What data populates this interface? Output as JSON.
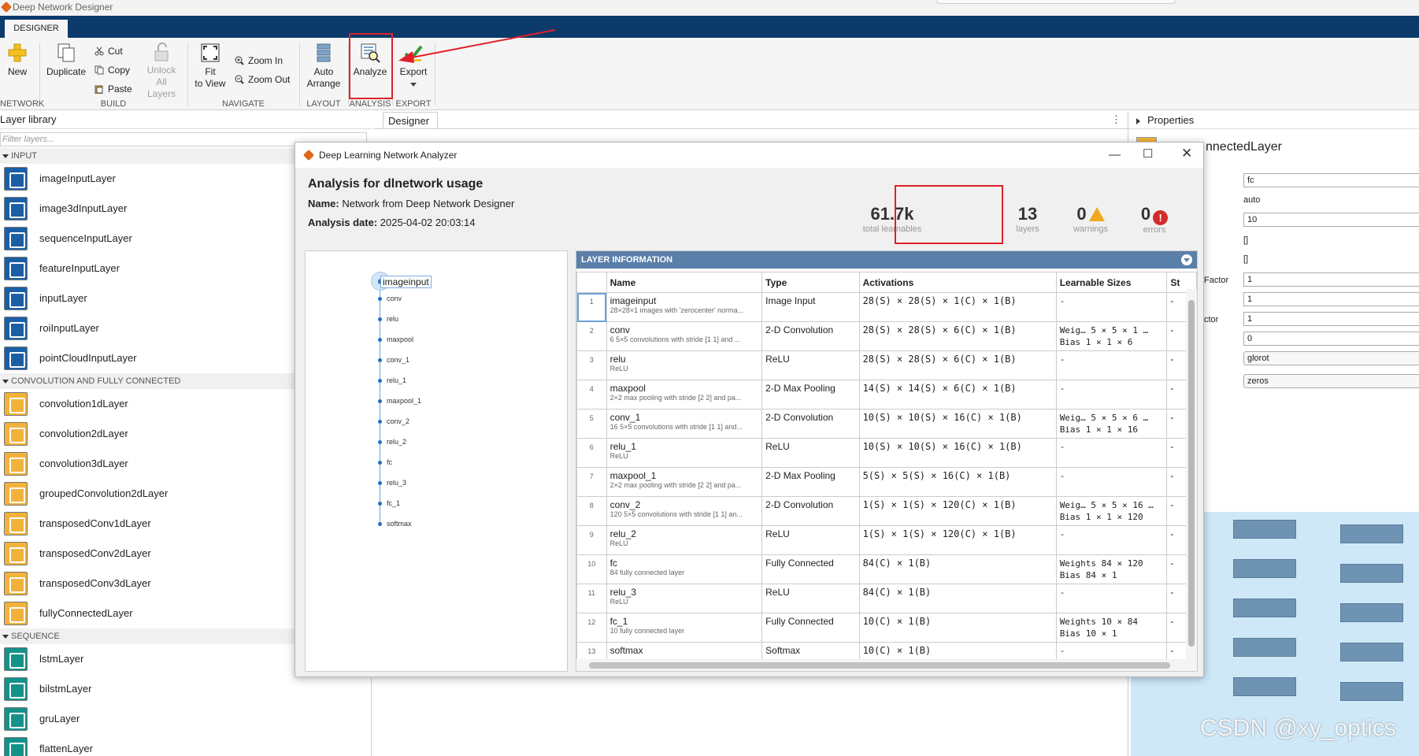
{
  "window": {
    "title": "Deep Network Designer"
  },
  "tab": {
    "label": "DESIGNER"
  },
  "ribbon": {
    "new_label": "New",
    "duplicate_label": "Duplicate",
    "cut_label": "Cut",
    "copy_label": "Copy",
    "paste_label": "Paste",
    "unlock_label": "Unlock",
    "all_layers_label": "All Layers",
    "fit_label": "Fit",
    "to_view_label": "to View",
    "zoom_in_label": "Zoom In",
    "zoom_out_label": "Zoom Out",
    "auto_label": "Auto",
    "arrange_label": "Arrange",
    "analyze_label": "Analyze",
    "export_label": "Export",
    "groups": {
      "network": "NETWORK",
      "build": "BUILD",
      "navigate": "NAVIGATE",
      "layout": "LAYOUT",
      "analysis": "ANALYSIS",
      "export": "EXPORT"
    }
  },
  "library": {
    "title": "Layer library",
    "filter_placeholder": "Filter layers...",
    "categories": [
      {
        "name": "INPUT",
        "items": [
          "imageInputLayer",
          "image3dInputLayer",
          "sequenceInputLayer",
          "featureInputLayer",
          "inputLayer",
          "roiInputLayer",
          "pointCloudInputLayer"
        ]
      },
      {
        "name": "CONVOLUTION AND FULLY CONNECTED",
        "items": [
          "convolution1dLayer",
          "convolution2dLayer",
          "convolution3dLayer",
          "groupedConvolution2dLayer",
          "transposedConv1dLayer",
          "transposedConv2dLayer",
          "transposedConv3dLayer",
          "fullyConnectedLayer"
        ]
      },
      {
        "name": "SEQUENCE",
        "items": [
          "lstmLayer",
          "bilstmLayer",
          "gruLayer",
          "flattenLayer"
        ]
      }
    ]
  },
  "designer": {
    "tab_label": "Designer",
    "menu_icon": "⋮"
  },
  "properties": {
    "title": "Properties",
    "layer_name": "nnectedLayer",
    "fields": [
      "fc",
      "10",
      "1",
      "1",
      "1",
      "0"
    ],
    "labels": [
      "auto",
      "[]",
      "[]"
    ],
    "side_labels": [
      "Factor",
      "ctor"
    ],
    "dropdowns": [
      "glorot",
      "zeros"
    ]
  },
  "analyzer": {
    "title": "Deep Learning Network Analyzer",
    "heading": "Analysis for dlnetwork usage",
    "name_label": "Name:",
    "name_value": "Network from Deep Network Designer",
    "date_label": "Analysis date:",
    "date_value": "2025-04-02 20:03:14",
    "stats": {
      "learnables": {
        "value": "61.7k",
        "label": "total learnables"
      },
      "layers": {
        "value": "13",
        "label": "layers"
      },
      "warnings": {
        "value": "0",
        "label": "warnings"
      },
      "errors": {
        "value": "0",
        "label": "errors"
      }
    },
    "graph": {
      "selected": "imageinput",
      "nodes": [
        "conv",
        "relu",
        "maxpool",
        "conv_1",
        "relu_1",
        "maxpool_1",
        "conv_2",
        "relu_2",
        "fc",
        "relu_3",
        "fc_1",
        "softmax"
      ]
    },
    "table": {
      "section_title": "LAYER INFORMATION",
      "columns": [
        "Name",
        "Type",
        "Activations",
        "Learnable Sizes",
        "St"
      ],
      "rows": [
        {
          "idx": "1",
          "name": "imageinput",
          "desc": "28×28×1 images with 'zerocenter' norma...",
          "type": "Image Input",
          "act": "28(S) × 28(S) × 1(C) × 1(B)",
          "l1": "-",
          "l2": ""
        },
        {
          "idx": "2",
          "name": "conv",
          "desc": "6 5×5 convolutions with stride [1 1] and ...",
          "type": "2-D Convolution",
          "act": "28(S) × 28(S) × 6(C) × 1(B)",
          "l1": "Weig…  5 × 5 × 1 …",
          "l2": "Bias   1 × 1 × 6"
        },
        {
          "idx": "3",
          "name": "relu",
          "desc": "ReLU",
          "type": "ReLU",
          "act": "28(S) × 28(S) × 6(C) × 1(B)",
          "l1": "-",
          "l2": ""
        },
        {
          "idx": "4",
          "name": "maxpool",
          "desc": "2×2 max pooling with stride [2 2] and pa...",
          "type": "2-D Max Pooling",
          "act": "14(S) × 14(S) × 6(C) × 1(B)",
          "l1": "-",
          "l2": ""
        },
        {
          "idx": "5",
          "name": "conv_1",
          "desc": "16 5×5 convolutions with stride [1 1] and...",
          "type": "2-D Convolution",
          "act": "10(S) × 10(S) × 16(C) × 1(B)",
          "l1": "Weig…  5 × 5 × 6 …",
          "l2": "Bias   1 × 1 × 16"
        },
        {
          "idx": "6",
          "name": "relu_1",
          "desc": "ReLU",
          "type": "ReLU",
          "act": "10(S) × 10(S) × 16(C) × 1(B)",
          "l1": "-",
          "l2": ""
        },
        {
          "idx": "7",
          "name": "maxpool_1",
          "desc": "2×2 max pooling with stride [2 2] and pa...",
          "type": "2-D Max Pooling",
          "act": "5(S) × 5(S) × 16(C) × 1(B)",
          "l1": "-",
          "l2": ""
        },
        {
          "idx": "8",
          "name": "conv_2",
          "desc": "120 5×5 convolutions with stride [1 1] an...",
          "type": "2-D Convolution",
          "act": "1(S) × 1(S) × 120(C) × 1(B)",
          "l1": "Weig…  5 × 5 × 16 …",
          "l2": "Bias   1 × 1 × 120"
        },
        {
          "idx": "9",
          "name": "relu_2",
          "desc": "ReLU",
          "type": "ReLU",
          "act": "1(S) × 1(S) × 120(C) × 1(B)",
          "l1": "-",
          "l2": ""
        },
        {
          "idx": "10",
          "name": "fc",
          "desc": "84 fully connected layer",
          "type": "Fully Connected",
          "act": "84(C) × 1(B)",
          "l1": "Weights  84 × 120",
          "l2": "Bias     84 × 1"
        },
        {
          "idx": "11",
          "name": "relu_3",
          "desc": "ReLU",
          "type": "ReLU",
          "act": "84(C) × 1(B)",
          "l1": "-",
          "l2": ""
        },
        {
          "idx": "12",
          "name": "fc_1",
          "desc": "10 fully connected layer",
          "type": "Fully Connected",
          "act": "10(C) × 1(B)",
          "l1": "Weights  10 × 84",
          "l2": "Bias     10 × 1"
        },
        {
          "idx": "13",
          "name": "softmax",
          "desc": "",
          "type": "Softmax",
          "act": "10(C) × 1(B)",
          "l1": "-",
          "l2": ""
        }
      ]
    }
  },
  "watermark": "CSDN @xy_optics",
  "colors": {
    "tabstrip": "#0b3a6b",
    "highlight": "#e0202a",
    "table_header": "#5a7fa9"
  }
}
